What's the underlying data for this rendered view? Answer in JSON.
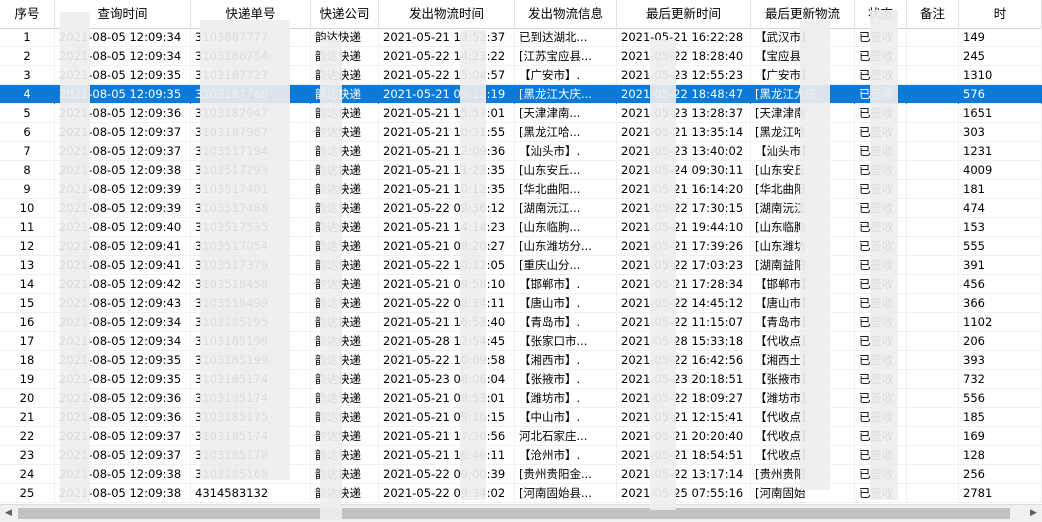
{
  "columns": [
    "序号",
    "查询时间",
    "快递单号",
    "快递公司",
    "发出物流时间",
    "发出物流信息",
    "最后更新时间",
    "最后更新物流",
    "状态",
    "备注",
    "时"
  ],
  "selected_index": 3,
  "rows": [
    [
      "1",
      "2021-08-05 12:09:34",
      "3103887777",
      "韵达快递",
      "2021-05-21 13:52:37",
      "已到达湖北...",
      "2021-05-21 16:22:28",
      "【武汉市】.",
      "已签收",
      "",
      "149"
    ],
    [
      "2",
      "2021-08-05 12:09:34",
      "3103186754",
      "韵达快递",
      "2021-05-22 14:23:22",
      "[江苏宝应县...",
      "2021-05-22 18:28:40",
      "【宝应县",
      "已签收",
      "",
      "245"
    ],
    [
      "3",
      "2021-08-05 12:09:35",
      "3103187727",
      "韵达快递",
      "2021-05-22 15:04:57",
      "【广安市】.",
      "2021-05-23 12:55:23",
      "【广安市】",
      "已签收",
      "",
      "1310"
    ],
    [
      "4",
      "2021-08-05 12:09:35",
      "3103187768",
      "韵达快递",
      "2021-05-21 09:12:19",
      "[黑龙江大庆...",
      "2021-05-22 18:48:47",
      "[黑龙江大庆",
      "已签收",
      "",
      "576"
    ],
    [
      "5",
      "2021-08-05 12:09:36",
      "3103187947",
      "韵达快递",
      "2021-05-21 15:57:01",
      "[天津津南...",
      "2021-05-23 13:28:37",
      "[天津津南",
      "已签收",
      "",
      "1651"
    ],
    [
      "6",
      "2021-08-05 12:09:37",
      "3103187987",
      "韵达快递",
      "2021-05-21 10:31:55",
      "[黑龙江哈...",
      "2021-05-21 13:35:14",
      "[黑龙江哈",
      "已签收",
      "",
      "303"
    ],
    [
      "7",
      "2021-08-05 12:09:37",
      "3103517194",
      "韵达快递",
      "2021-05-21 12:09:36",
      "【汕头市】.",
      "2021-05-23 13:40:02",
      "【汕头市】",
      "已签收",
      "",
      "1231"
    ],
    [
      "8",
      "2021-08-05 12:09:38",
      "3103517293",
      "韵达快递",
      "2021-05-21 11:23:35",
      "[山东安丘...",
      "2021-05-24 09:30:11",
      "[山东安丘",
      "已签收",
      "",
      "4009"
    ],
    [
      "9",
      "2021-08-05 12:09:39",
      "3103517401",
      "韵达快递",
      "2021-05-21 10:12:35",
      "[华北曲阳...",
      "2021-05-21 16:14:20",
      "[华北曲阳",
      "已签收",
      "",
      "181"
    ],
    [
      "10",
      "2021-08-05 12:09:39",
      "3103517488",
      "韵达快递",
      "2021-05-22 09:36:12",
      "[湖南沅江...",
      "2021-05-22 17:30:15",
      "[湖南沅江",
      "已签收",
      "",
      "474"
    ],
    [
      "11",
      "2021-08-05 12:09:40",
      "3103517535",
      "韵达快递",
      "2021-05-21 14:14:23",
      "[山东临朐...",
      "2021-05-21 19:44:10",
      "[山东临朐",
      "已签收",
      "",
      "153"
    ],
    [
      "12",
      "2021-08-05 12:09:41",
      "3103517054",
      "韵达快递",
      "2021-05-21 08:20:27",
      "[山东潍坊分...",
      "2021-05-21 17:39:26",
      "[山东潍坊",
      "已签收",
      "",
      "555"
    ],
    [
      "13",
      "2021-08-05 12:09:41",
      "3103517379",
      "韵达快递",
      "2021-05-22 10:12:05",
      "[重庆山分...",
      "2021-05-22 17:03:23",
      "[湖南益阳",
      "已签收",
      "",
      "391"
    ],
    [
      "14",
      "2021-08-05 12:09:42",
      "3103518458",
      "韵达快递",
      "2021-05-21 09:58:10",
      "【邯郸市】.",
      "2021-05-21 17:28:34",
      "【邯郸市】",
      "已签收",
      "",
      "456"
    ],
    [
      "15",
      "2021-08-05 12:09:43",
      "3103518499",
      "韵达快递",
      "2021-05-22 08:34:11",
      "【唐山市】.",
      "2021-05-22 14:45:12",
      "【唐山市】",
      "已签收",
      "",
      "366"
    ],
    [
      "16",
      "2021-08-05 12:09:34",
      "3103185195",
      "韵达快递",
      "2021-05-21 16:53:40",
      "【青岛市】.",
      "2021-05-22 11:15:07",
      "【青岛市】",
      "已签收",
      "",
      "1102"
    ],
    [
      "17",
      "2021-08-05 12:09:34",
      "3103185199",
      "韵达快递",
      "2021-05-28 12:54:45",
      "【张家口市...",
      "2021-05-28 15:33:18",
      "【代收点】",
      "已签收",
      "",
      "206"
    ],
    [
      "18",
      "2021-08-05 12:09:35",
      "3103185199",
      "韵达快递",
      "2021-05-22 10:09:58",
      "【湘西市】.",
      "2021-05-22 16:42:56",
      "【湘西土】",
      "已签收",
      "",
      "393"
    ],
    [
      "19",
      "2021-08-05 12:09:35",
      "3103185174",
      "韵达快递",
      "2021-05-23 08:06:04",
      "【张掖市】.",
      "2021-05-23 20:18:51",
      "【张掖市】",
      "已签收",
      "",
      "732"
    ],
    [
      "20",
      "2021-08-05 12:09:36",
      "3103185174",
      "韵达快递",
      "2021-05-21 08:53:01",
      "【潍坊市】.",
      "2021-05-22 18:09:27",
      "【潍坊市】",
      "已签收",
      "",
      "556"
    ],
    [
      "21",
      "2021-08-05 12:09:36",
      "3103185175",
      "韵达快递",
      "2021-05-21 09:10:15",
      "【中山市】.",
      "2021-05-21 12:15:41",
      "【代收点】",
      "已签收",
      "",
      "185"
    ],
    [
      "22",
      "2021-08-05 12:09:37",
      "3103185174",
      "韵达快递",
      "2021-05-21 17:30:56",
      "河北石家庄...",
      "2021-05-21 20:20:40",
      "【代收点】",
      "已签收",
      "",
      "169"
    ],
    [
      "23",
      "2021-08-05 12:09:37",
      "3103185178",
      "韵达快递",
      "2021-05-21 16:46:11",
      "【沧州市】.",
      "2021-05-21 18:54:51",
      "【代收点】",
      "已签收",
      "",
      "128"
    ],
    [
      "24",
      "2021-08-05 12:09:38",
      "3103185168",
      "韵达快递",
      "2021-05-22 09:00:39",
      "[贵州贵阳金...",
      "2021-05-22 13:17:14",
      "[贵州贵阳",
      "已签收",
      "",
      "256"
    ],
    [
      "25",
      "2021-08-05 12:09:38",
      "4314583132",
      "韵达快递",
      "2021-05-22 09:34:02",
      "[河南固始县...",
      "2021-05-25 07:55:16",
      "[河南固始",
      "已签收",
      "",
      "2781"
    ]
  ],
  "scrollbar": {
    "left_arrow": "◀",
    "right_arrow": "▶"
  }
}
